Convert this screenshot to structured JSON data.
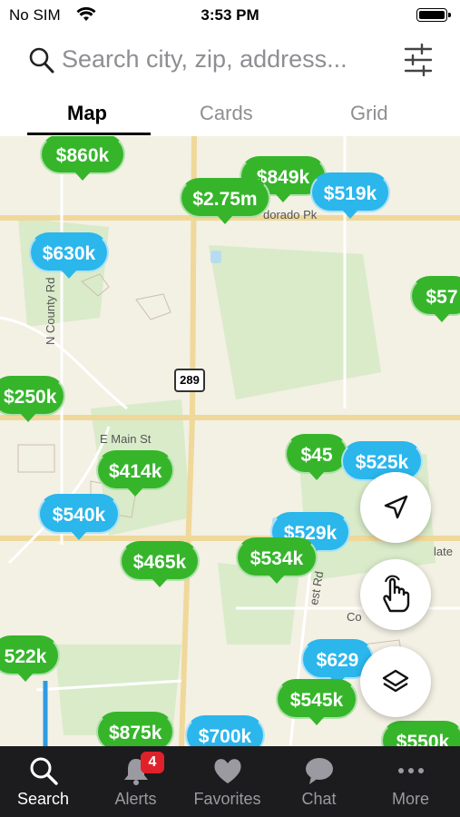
{
  "status": {
    "carrier": "No SIM",
    "time": "3:53 PM"
  },
  "search": {
    "placeholder": "Search city, zip, address..."
  },
  "tabs": [
    {
      "label": "Map",
      "active": true
    },
    {
      "label": "Cards",
      "active": false
    },
    {
      "label": "Grid",
      "active": false
    }
  ],
  "map": {
    "road_labels": [
      "E Main St",
      "N County Rd",
      "289",
      "dorado Pk",
      "Co",
      "est Rd",
      "late"
    ],
    "pins": [
      {
        "price": "$860k",
        "color": "green"
      },
      {
        "price": "$849k",
        "color": "green"
      },
      {
        "price": "$2.75m",
        "color": "green"
      },
      {
        "price": "$519k",
        "color": "blue"
      },
      {
        "price": "$630k",
        "color": "blue"
      },
      {
        "price": "$57",
        "color": "green"
      },
      {
        "price": "$250k",
        "color": "green"
      },
      {
        "price": "$45",
        "color": "green"
      },
      {
        "price": "$525k",
        "color": "blue"
      },
      {
        "price": "$414k",
        "color": "green"
      },
      {
        "price": "$540k",
        "color": "blue"
      },
      {
        "price": "$529k",
        "color": "blue"
      },
      {
        "price": "$465k",
        "color": "green"
      },
      {
        "price": "$534k",
        "color": "green"
      },
      {
        "price": "522k",
        "color": "green"
      },
      {
        "price": "$629",
        "color": "blue"
      },
      {
        "price": "$545k",
        "color": "green"
      },
      {
        "price": "$875k",
        "color": "green"
      },
      {
        "price": "$700k",
        "color": "blue"
      },
      {
        "price": "$550k",
        "color": "green"
      }
    ]
  },
  "tabbar": [
    {
      "label": "Search",
      "icon": "search-icon",
      "active": true
    },
    {
      "label": "Alerts",
      "icon": "bell-icon",
      "active": false,
      "badge": "4"
    },
    {
      "label": "Favorites",
      "icon": "heart-icon",
      "active": false
    },
    {
      "label": "Chat",
      "icon": "chat-bubble-icon",
      "active": false
    },
    {
      "label": "More",
      "icon": "more-dots-icon",
      "active": false
    }
  ],
  "colors": {
    "green_pin": "#36b52b",
    "blue_pin": "#2bb6ec",
    "tabbar_bg": "#1c1c1e",
    "badge": "#e0212a"
  }
}
